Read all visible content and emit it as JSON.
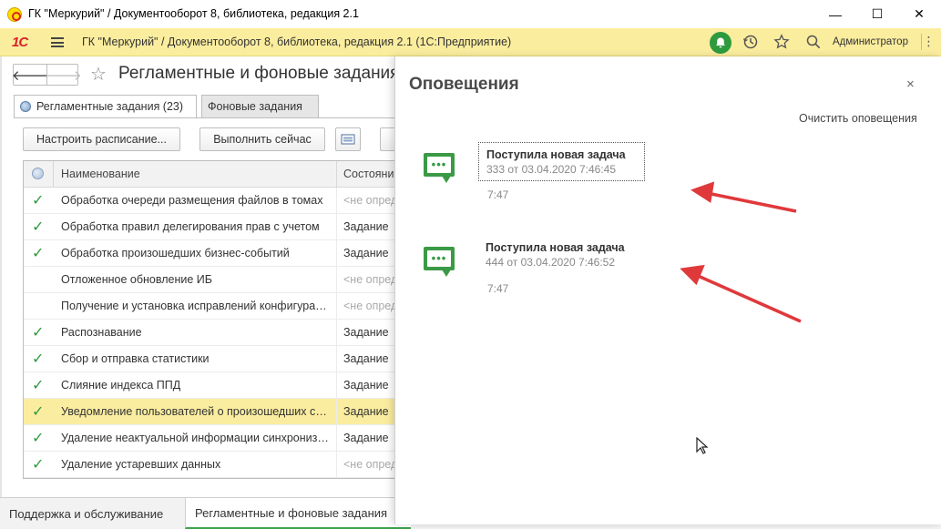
{
  "window": {
    "title": "ГК \"Меркурий\" / Документооборот 8, библиотека, редакция 2.1",
    "minimize_icon": "—",
    "maximize_icon": "☐",
    "close_icon": "✕"
  },
  "appbar": {
    "logo": "1С",
    "title": "ГК \"Меркурий\" / Документооборот 8, библиотека, редакция 2.1  (1С:Предприятие)",
    "user": "Администратор",
    "icons": [
      "bell-icon",
      "history-icon",
      "star-icon",
      "search-icon"
    ]
  },
  "form": {
    "back": "🡐",
    "forward": "🡒",
    "star": "☆",
    "title": "Регламентные и фоновые задания",
    "tabs": [
      {
        "label": "Регламентные задания (23)",
        "active": true
      },
      {
        "label": "Фоновые задания",
        "active": false
      }
    ],
    "buttons": {
      "schedule": "Настроить расписание...",
      "run_now": "Выполнить сейчас"
    },
    "grid": {
      "columns": [
        "Наименование",
        "Состояние"
      ],
      "rows": [
        {
          "check": "✓",
          "name": "Обработка очереди размещения файлов в томах",
          "state": "<не определено>",
          "muted": true
        },
        {
          "check": "✓",
          "name": "Обработка правил делегирования прав с учетом",
          "state": "Задание",
          "muted": false
        },
        {
          "check": "✓",
          "name": "Обработка произошедших бизнес-событий",
          "state": "Задание",
          "muted": false
        },
        {
          "check": "",
          "name": "Отложенное обновление ИБ",
          "state": "<не определено>",
          "muted": true
        },
        {
          "check": "",
          "name": "Получение и установка исправлений конфигурации",
          "state": "<не определено>",
          "muted": true
        },
        {
          "check": "✓",
          "name": "Распознавание",
          "state": "Задание",
          "muted": false
        },
        {
          "check": "✓",
          "name": "Сбор и отправка статистики",
          "state": "Задание",
          "muted": false
        },
        {
          "check": "✓",
          "name": "Слияние индекса ППД",
          "state": "Задание",
          "muted": false
        },
        {
          "check": "✓",
          "name": "Уведомление пользователей о произошедших событиях",
          "state": "Задание",
          "muted": false,
          "selected": true
        },
        {
          "check": "✓",
          "name": "Удаление неактуальной информации синхронизации",
          "state": "Задание",
          "muted": false
        },
        {
          "check": "✓",
          "name": "Удаление устаревших данных",
          "state": "<не определено>",
          "muted": true
        }
      ]
    }
  },
  "bottom_tabs": [
    {
      "label": "Поддержка и обслуживание",
      "active": false
    },
    {
      "label": "Регламентные и фоновые задания",
      "close": "×",
      "active": true
    }
  ],
  "notifications": {
    "title": "Оповещения",
    "close": "×",
    "clear": "Очистить оповещения",
    "items": [
      {
        "heading": "Поступила новая задача",
        "detail": "333 от 03.04.2020 7:46:45",
        "time": "7:47"
      },
      {
        "heading": "Поступила новая задача",
        "detail": "444 от 03.04.2020 7:46:52",
        "time": "7:47"
      }
    ],
    "icon_text": "•••"
  },
  "colors": {
    "appbar": "#fbed9e",
    "accent_green": "#2e9a3e",
    "selected_row": "#fbeda0",
    "arrow_red": "#e0393b"
  }
}
